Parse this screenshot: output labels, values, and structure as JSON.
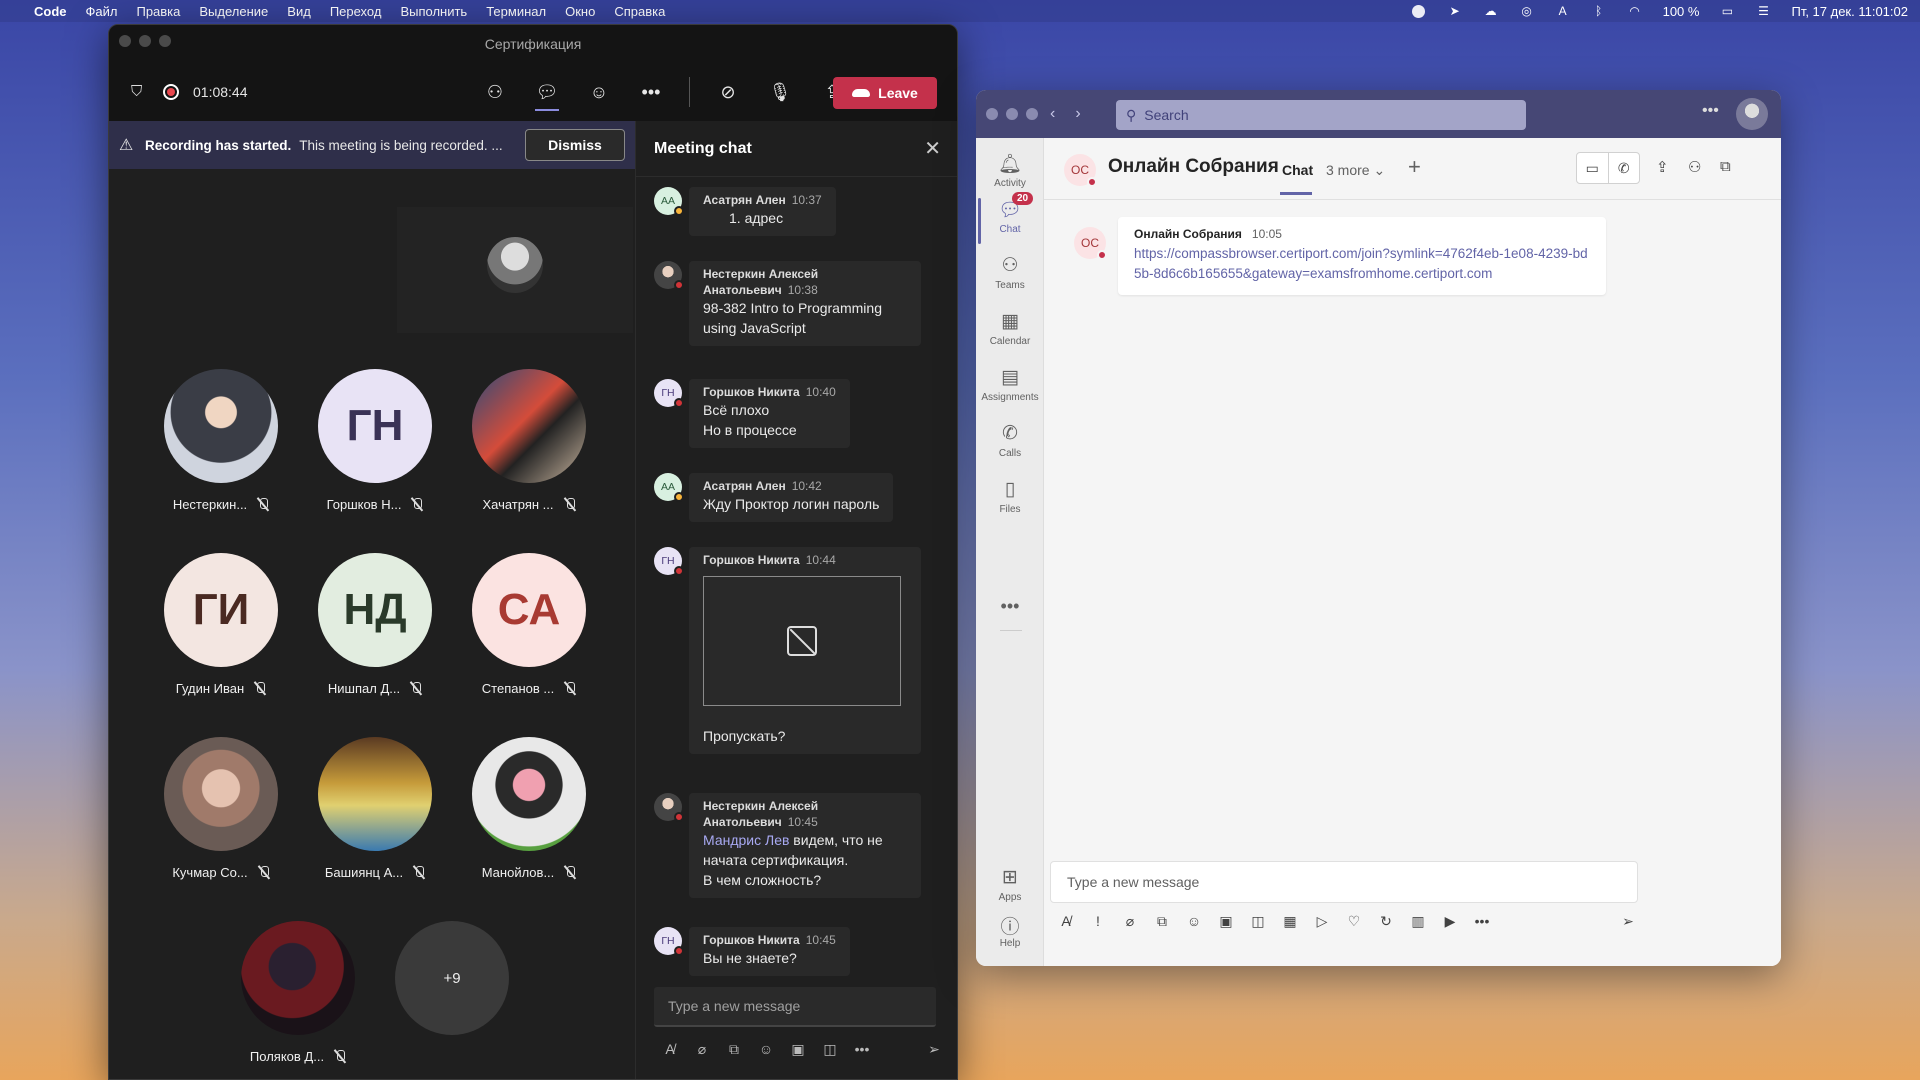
{
  "menubar": {
    "app": "Code",
    "items": [
      "Файл",
      "Правка",
      "Выделение",
      "Вид",
      "Переход",
      "Выполнить",
      "Терминал",
      "Окно",
      "Справка"
    ],
    "battery": "100 %",
    "datetime": "Пт, 17 дек.  11:01:02"
  },
  "meeting": {
    "window_title": "Сертификация",
    "timer": "01:08:44",
    "leave_label": "Leave",
    "banner": {
      "bold": "Recording has started.",
      "text": "This meeting is being recorded. ...",
      "dismiss": "Dismiss"
    },
    "participants": [
      {
        "name": "Нестеркин...",
        "initials": ""
      },
      {
        "name": "Горшков Н...",
        "initials": "ГН",
        "bg": "#e8e3f5",
        "fg": "#3a3256"
      },
      {
        "name": "Хачатрян ...",
        "initials": ""
      },
      {
        "name": "Гудин Иван",
        "initials": "ГИ",
        "bg": "#f3e6e1",
        "fg": "#4a2a22"
      },
      {
        "name": "Нишпал Д...",
        "initials": "НД",
        "bg": "#e2ede0",
        "fg": "#2a3a2a"
      },
      {
        "name": "Степанов ...",
        "initials": "СА",
        "bg": "#fbe3e1",
        "fg": "#a83a32"
      },
      {
        "name": "Кучмар Со...",
        "initials": ""
      },
      {
        "name": "Башиянц А...",
        "initials": ""
      },
      {
        "name": "Манойлов...",
        "initials": ""
      },
      {
        "name": "Поляков Д...",
        "initials": ""
      }
    ],
    "overflow": "+9",
    "chat": {
      "title": "Meeting chat",
      "input_placeholder": "Type a new message",
      "messages": [
        {
          "author": "Асатрян Ален",
          "time": "10:37",
          "initials": "АА",
          "lines": [
            "1. адрес"
          ]
        },
        {
          "author": "Нестеркин Алексей",
          "author2": "Анатольевич",
          "time": "10:38",
          "lines": [
            "98-382 Intro to Programming",
            "using JavaScript"
          ]
        },
        {
          "author": "Горшков Никита",
          "time": "10:40",
          "initials": "ГН",
          "lines": [
            "Всё плохо",
            "Но в процессе"
          ]
        },
        {
          "author": "Асатрян Ален",
          "time": "10:42",
          "initials": "АА",
          "lines": [
            "Жду Проктор логин пароль"
          ]
        },
        {
          "author": "Горшков Никита",
          "time": "10:44",
          "initials": "ГН",
          "lines": [
            "Пропускать?"
          ]
        },
        {
          "author": "Нестеркин Алексей",
          "author2": "Анатольевич",
          "time": "10:45",
          "mention": "Мандрис Лев",
          "lines": [
            " видем, что не",
            "начата сертификация.",
            "В чем сложность?"
          ]
        },
        {
          "author": "Горшков Никита",
          "time": "10:45",
          "initials": "ГН",
          "lines": [
            "Вы не знаете?"
          ]
        }
      ]
    }
  },
  "teams": {
    "search_placeholder": "Search",
    "rail": [
      {
        "label": "Activity",
        "icon": "bell-icon"
      },
      {
        "label": "Chat",
        "icon": "chat-icon",
        "badge": "20"
      },
      {
        "label": "Teams",
        "icon": "teams-icon"
      },
      {
        "label": "Calendar",
        "icon": "calendar-icon"
      },
      {
        "label": "Assignments",
        "icon": "assignments-icon"
      },
      {
        "label": "Calls",
        "icon": "phone-icon"
      },
      {
        "label": "Files",
        "icon": "file-icon"
      },
      {
        "label": "Apps",
        "icon": "apps-icon"
      },
      {
        "label": "Help",
        "icon": "help-icon"
      }
    ],
    "header": {
      "initials": "ОС",
      "title": "Онлайн Собрания",
      "tab": "Chat",
      "more": "3 more"
    },
    "post": {
      "initials": "ОС",
      "author": "Онлайн Собрания",
      "time": "10:05",
      "link": "https://compassbrowser.certiport.com/join?symlink=4762f4eb-1e08-4239-bd5b-8d6c6b165655&gateway=examsfromhome.certiport.com"
    },
    "input_placeholder": "Type a new message"
  }
}
